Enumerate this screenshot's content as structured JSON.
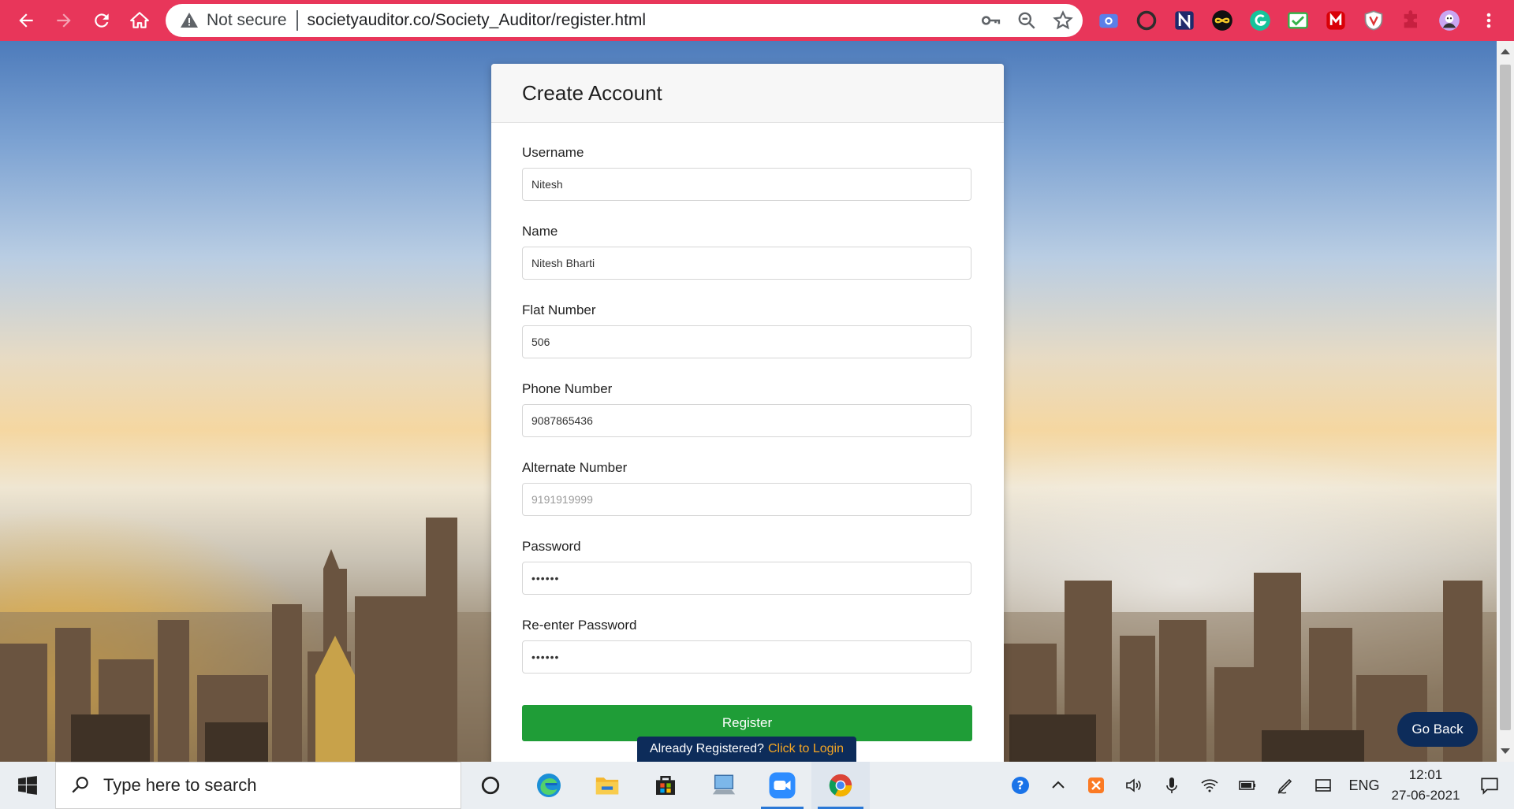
{
  "browser": {
    "security_label": "Not secure",
    "url": "societyauditor.co/Society_Auditor/register.html",
    "accent_color": "#e8365a",
    "nav_icons": [
      "back-arrow-icon",
      "forward-arrow-icon",
      "reload-icon",
      "home-icon"
    ],
    "omnibox_icons": [
      "key-icon",
      "zoom-icon",
      "star-icon"
    ],
    "extensions": [
      "screenshot-icon",
      "opera-icon",
      "notion-icon",
      "infinity-icon",
      "grammarly-icon",
      "email-tracker-icon",
      "mega-icon",
      "shield-icon",
      "puzzle-icon",
      "profile-avatar"
    ],
    "menu_icon": "more-vert-icon"
  },
  "form": {
    "title": "Create Account",
    "fields": [
      {
        "label": "Username",
        "value": "Nitesh",
        "placeholder": ""
      },
      {
        "label": "Name",
        "value": "Nitesh Bharti",
        "placeholder": ""
      },
      {
        "label": "Flat Number",
        "value": "506",
        "placeholder": ""
      },
      {
        "label": "Phone Number",
        "value": "9087865436",
        "placeholder": ""
      },
      {
        "label": "Alternate Number",
        "value": "",
        "placeholder": "9191919999"
      },
      {
        "label": "Password",
        "value": "••••••",
        "placeholder": ""
      },
      {
        "label": "Re-enter Password",
        "value": "••••••",
        "placeholder": ""
      }
    ],
    "register_label": "Register",
    "register_color": "#1f9d37",
    "already_text": "Already Registered?",
    "login_link": "Click to Login",
    "link_color": "#f5a623",
    "go_back_label": "Go Back",
    "badge_color": "#0d2c5a"
  },
  "taskbar": {
    "search_placeholder": "Type here to search",
    "apps": [
      "cortana-icon",
      "edge-icon",
      "file-explorer-icon",
      "store-icon",
      "computer-icon",
      "zoom-app-icon",
      "chrome-icon"
    ],
    "tray_icons": [
      "help-icon",
      "chevron-up-icon",
      "xampp-icon",
      "speaker-icon",
      "microphone-icon",
      "wifi-icon",
      "battery-icon",
      "pen-icon",
      "tablet-icon"
    ],
    "language": "ENG",
    "time": "12:01",
    "date": "27-06-2021"
  }
}
